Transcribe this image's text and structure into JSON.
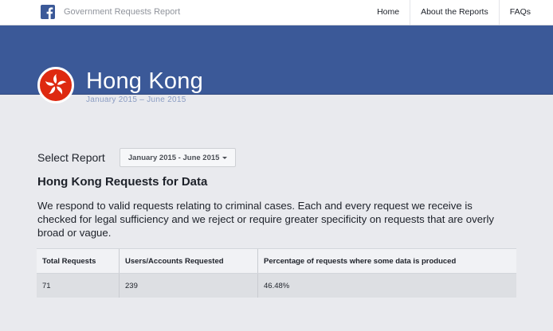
{
  "header": {
    "site_title": "Government Requests Report",
    "logo_icon": "facebook-logo-icon",
    "nav": [
      "Home",
      "About the Reports",
      "FAQs"
    ]
  },
  "hero": {
    "country": "Hong Kong",
    "period": "January 2015 – June 2015",
    "flag_icon": "hong-kong-flag-icon"
  },
  "report_select": {
    "label": "Select Report",
    "value": "January 2015 - June 2015"
  },
  "section": {
    "title": "Hong Kong Requests for Data",
    "description": "We respond to valid requests relating to criminal cases. Each and every request we receive is checked for legal sufficiency and we reject or require greater specificity on requests that are overly broad or vague."
  },
  "table": {
    "headers": [
      "Total Requests",
      "Users/Accounts Requested",
      "Percentage of requests where some data is produced"
    ],
    "rows": [
      [
        "71",
        "239",
        "46.48%"
      ]
    ]
  },
  "colors": {
    "brand_blue": "#3b5998",
    "flag_red": "#de2910"
  }
}
